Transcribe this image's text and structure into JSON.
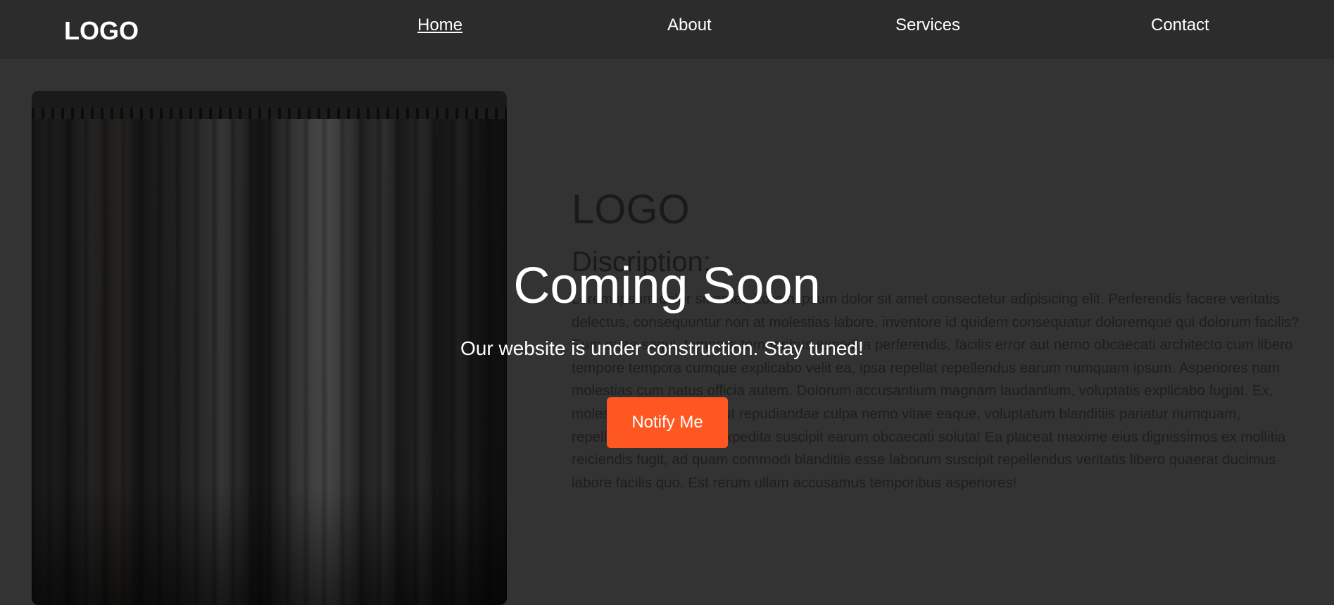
{
  "nav": {
    "logo": "LOGO",
    "links": [
      {
        "label": "Home",
        "active": true
      },
      {
        "label": "About",
        "active": false
      },
      {
        "label": "Services",
        "active": false
      },
      {
        "label": "Contact",
        "active": false
      }
    ]
  },
  "content": {
    "logo": "LOGO",
    "heading": "Discription:",
    "body": "Lorem ipsum dolor sit amet, Lorem ipsum dolor sit amet consectetur adipisicing elit. Perferendis facere veritatis delectus, consequuntur non at molestias labore, inventore id quidem consequatur doloremque qui dolorum facilis? Eum quae sequi, tempora temporibus expedita perferendis, facilis error aut nemo obcaecati architecto cum libero tempore tempora cumque explicabo velit ea, ipsa repellat repellendus earum numquam ipsum. Asperiores nam molestias cum natus officia autem. Dolorum accusantium magnam laudantium, voluptatis explicabo fugiat. Ex, molestias? Temporibus ut repudiandae culpa nemo vitae eaque, voluptatum blanditiis pariatur numquam, repellendus ipsa quod expedita suscipit earum obcaecati soluta! Ea placeat maxime eius dignissimos ex mollitia reiciendis fugit, ad quam commodi blanditiis esse laborum suscipit repellendus veritatis libero quaerat ducimus labore facilis quo. Est rerum ullam accusamus temporibus asperiores!"
  },
  "overlay": {
    "title": "Coming Soon",
    "subtitle": "Our website is under construction. Stay tuned!",
    "button_label": "Notify Me"
  },
  "colors": {
    "page_background": "#333333",
    "navbar_background": "#2c2c2c",
    "accent": "#ff5722",
    "text_light": "#ffffff"
  },
  "images": {
    "hero": "clothes-rack-photo"
  }
}
